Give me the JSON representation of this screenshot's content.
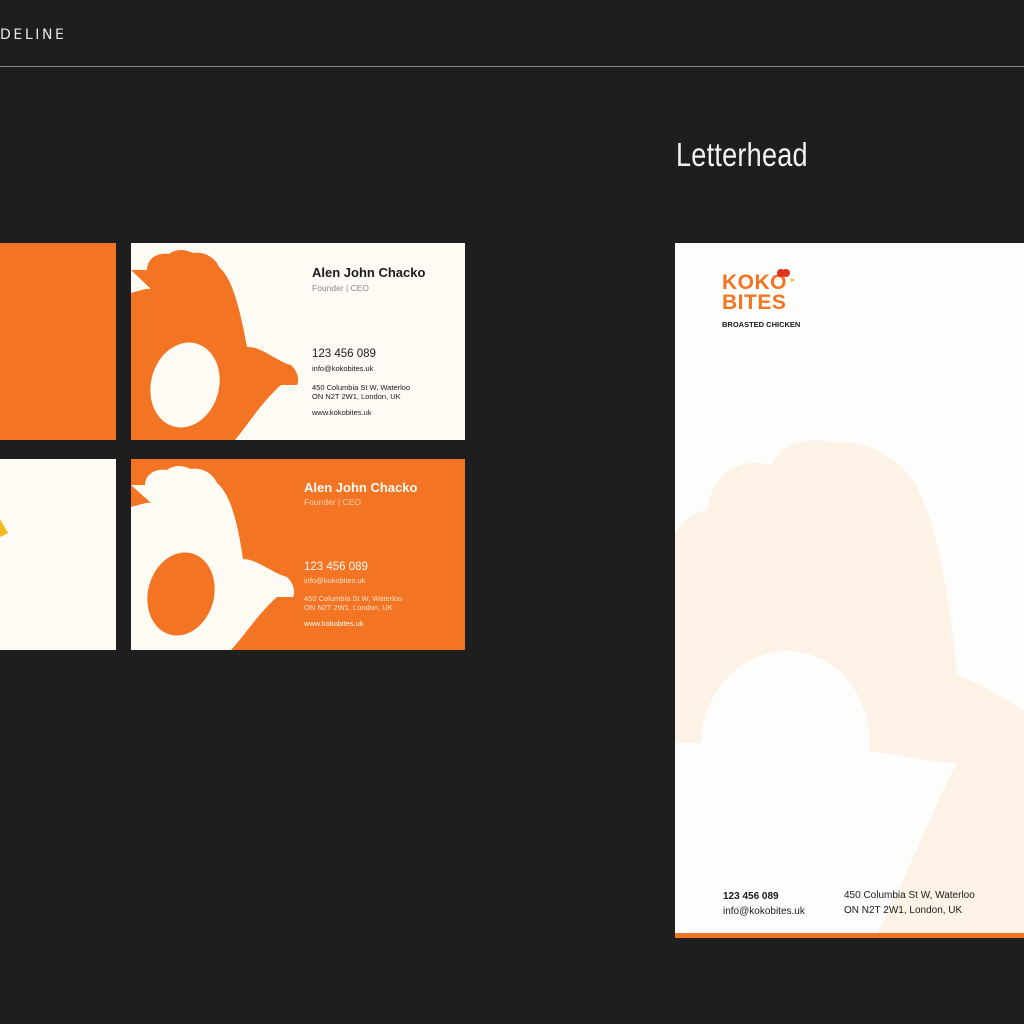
{
  "header": {
    "title": "DELINE"
  },
  "letterhead_section": {
    "heading": "Letterhead"
  },
  "colors": {
    "brand_orange": "#f37423",
    "cream": "#fdfbf3",
    "background": "#1e1e1e",
    "brand_red": "#e4311f"
  },
  "business_card": {
    "name": "Alen John Chacko",
    "role": "Founder | CEO",
    "phone": "123 456 089",
    "email": "info@kokobites.uk",
    "address_line1": "450 Columbia St W, Waterloo",
    "address_line2": "ON N2T 2W1, London, UK",
    "website": "www.kokobites.uk"
  },
  "letterhead": {
    "logo_line1": "KOKO",
    "logo_line2": "BITES",
    "tagline": "BROASTED CHICKEN",
    "phone": "123 456 089",
    "email": "info@kokobites.uk",
    "address_line1": "450 Columbia St W, Waterloo",
    "address_line2": "ON N2T 2W1, London, UK"
  }
}
